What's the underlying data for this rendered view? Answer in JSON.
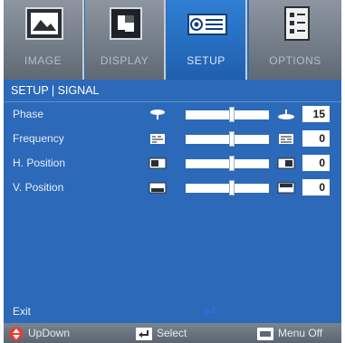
{
  "tabs": [
    {
      "label": "IMAGE",
      "icon": "image-icon",
      "active": false
    },
    {
      "label": "DISPLAY",
      "icon": "display-icon",
      "active": false
    },
    {
      "label": "SETUP",
      "icon": "projector-icon",
      "active": true
    },
    {
      "label": "OPTIONS",
      "icon": "options-icon",
      "active": false
    }
  ],
  "breadcrumb": "SETUP | SIGNAL",
  "settings": [
    {
      "label": "Phase",
      "value": "15",
      "level": 0.55
    },
    {
      "label": "Frequency",
      "value": "0",
      "level": 0.55
    },
    {
      "label": "H. Position",
      "value": "0",
      "level": 0.55
    },
    {
      "label": "V. Position",
      "value": "0",
      "level": 0.55
    }
  ],
  "exit_label": "Exit",
  "footer": {
    "updown": "UpDown",
    "select": "Select",
    "menu_off": "Menu Off"
  },
  "colors": {
    "background": "#2c69b8",
    "active_tab": "#2f7fd4",
    "footer": "#6b7580",
    "updown_icon": "#e63c2e"
  }
}
